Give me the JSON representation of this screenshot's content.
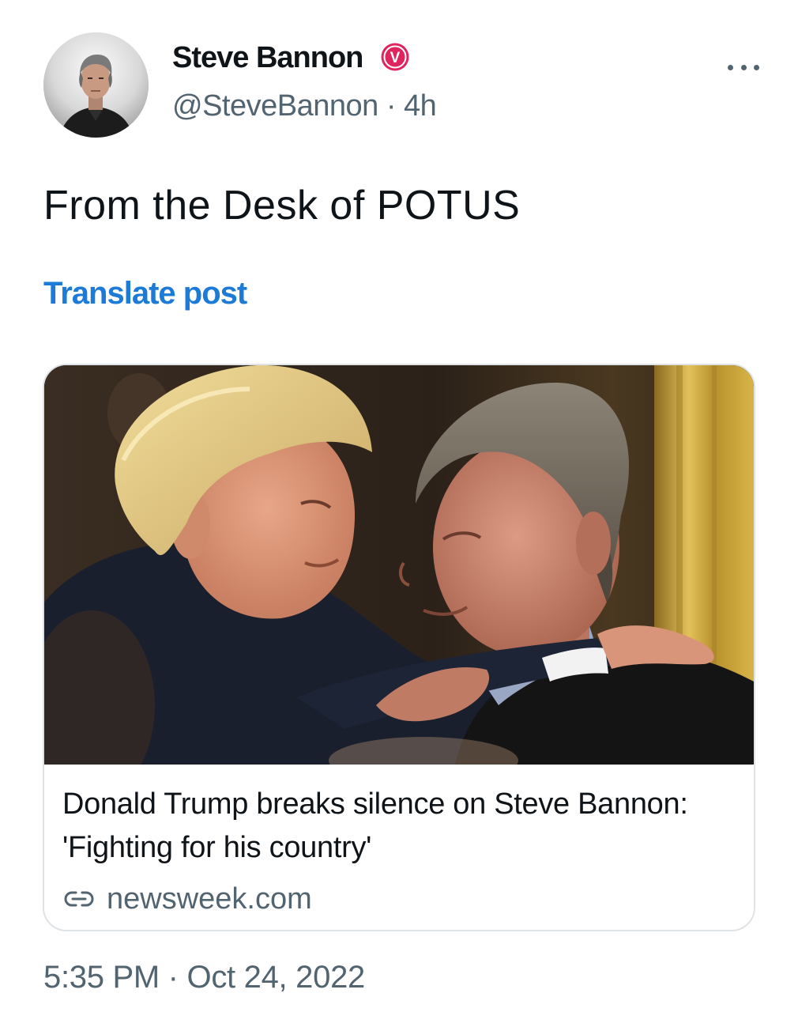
{
  "author": {
    "display_name": "Steve Bannon",
    "handle_time": "@SteveBannon · 4h",
    "verified_badge_letter": "V",
    "badge_color": "#e0245e"
  },
  "post": {
    "text": "From the Desk of POTUS",
    "translate_label": "Translate post",
    "timestamp": "5:35 PM · Oct 24, 2022"
  },
  "link_card": {
    "title": "Donald Trump breaks silence on Steve Bannon: 'Fighting for his country'",
    "domain": "newsweek.com"
  },
  "icons": {
    "more": "more-horizontal-icon",
    "link": "link-icon",
    "verified": "verified-badge-icon"
  },
  "colors": {
    "link_blue": "#1d7bd8",
    "secondary_text": "#536471",
    "primary_text": "#0f1419",
    "card_border": "#dfe3e6"
  }
}
